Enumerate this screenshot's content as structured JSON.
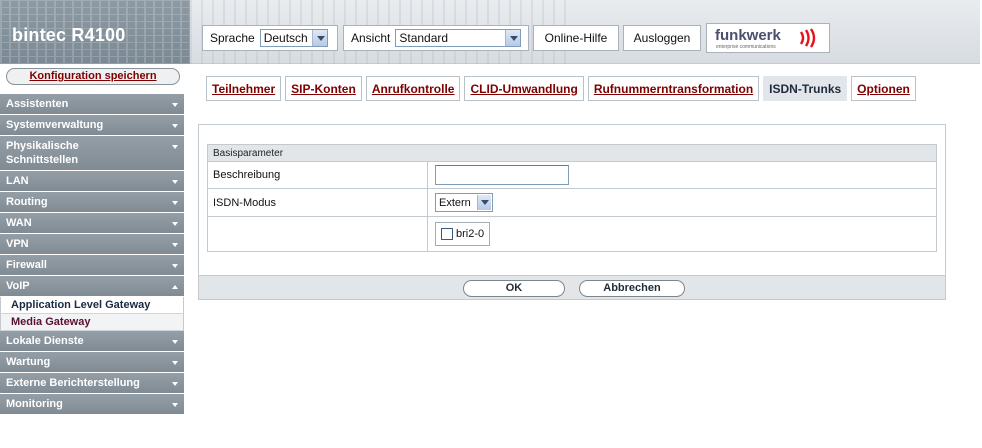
{
  "header": {
    "title": "bintec R4100",
    "language_label": "Sprache",
    "language_value": "Deutsch",
    "view_label": "Ansicht",
    "view_value": "Standard",
    "help_label": "Online-Hilfe",
    "logout_label": "Ausloggen",
    "logo_text": "funkwerk",
    "logo_subtext": "enterprise communications"
  },
  "sidebar": {
    "save_label": "Konfiguration speichern",
    "items": [
      {
        "label": "Assistenten",
        "expanded": false
      },
      {
        "label": "Systemverwaltung",
        "expanded": false
      },
      {
        "label": "Physikalische Schnittstellen",
        "expanded": false
      },
      {
        "label": "LAN",
        "expanded": false
      },
      {
        "label": "Routing",
        "expanded": false
      },
      {
        "label": "WAN",
        "expanded": false
      },
      {
        "label": "VPN",
        "expanded": false
      },
      {
        "label": "Firewall",
        "expanded": false
      },
      {
        "label": "VoIP",
        "expanded": true
      },
      {
        "label": "Lokale Dienste",
        "expanded": false
      },
      {
        "label": "Wartung",
        "expanded": false
      },
      {
        "label": "Externe Berichterstellung",
        "expanded": false
      },
      {
        "label": "Monitoring",
        "expanded": false
      }
    ],
    "voip_subitems": [
      {
        "label": "Application Level Gateway",
        "active": false
      },
      {
        "label": "Media Gateway",
        "active": true
      }
    ]
  },
  "tabs": [
    {
      "label": "Teilnehmer",
      "active": false
    },
    {
      "label": "SIP-Konten",
      "active": false
    },
    {
      "label": "Anrufkontrolle",
      "active": false
    },
    {
      "label": "CLID-Umwandlung",
      "active": false
    },
    {
      "label": "Rufnummerntransformation",
      "active": false
    },
    {
      "label": "ISDN-Trunks",
      "active": true
    },
    {
      "label": "Optionen",
      "active": false
    }
  ],
  "form": {
    "section_title": "Basisparameter",
    "description_label": "Beschreibung",
    "description_value": "",
    "isdn_mode_label": "ISDN-Modus",
    "isdn_mode_value": "Extern",
    "interface_label": "bri2-0",
    "interface_checked": false,
    "ok_label": "OK",
    "cancel_label": "Abbrechen"
  },
  "colors": {
    "link": "#800000",
    "sidebar_bg": "#8a959e",
    "panel_header": "#e3e6e9"
  }
}
